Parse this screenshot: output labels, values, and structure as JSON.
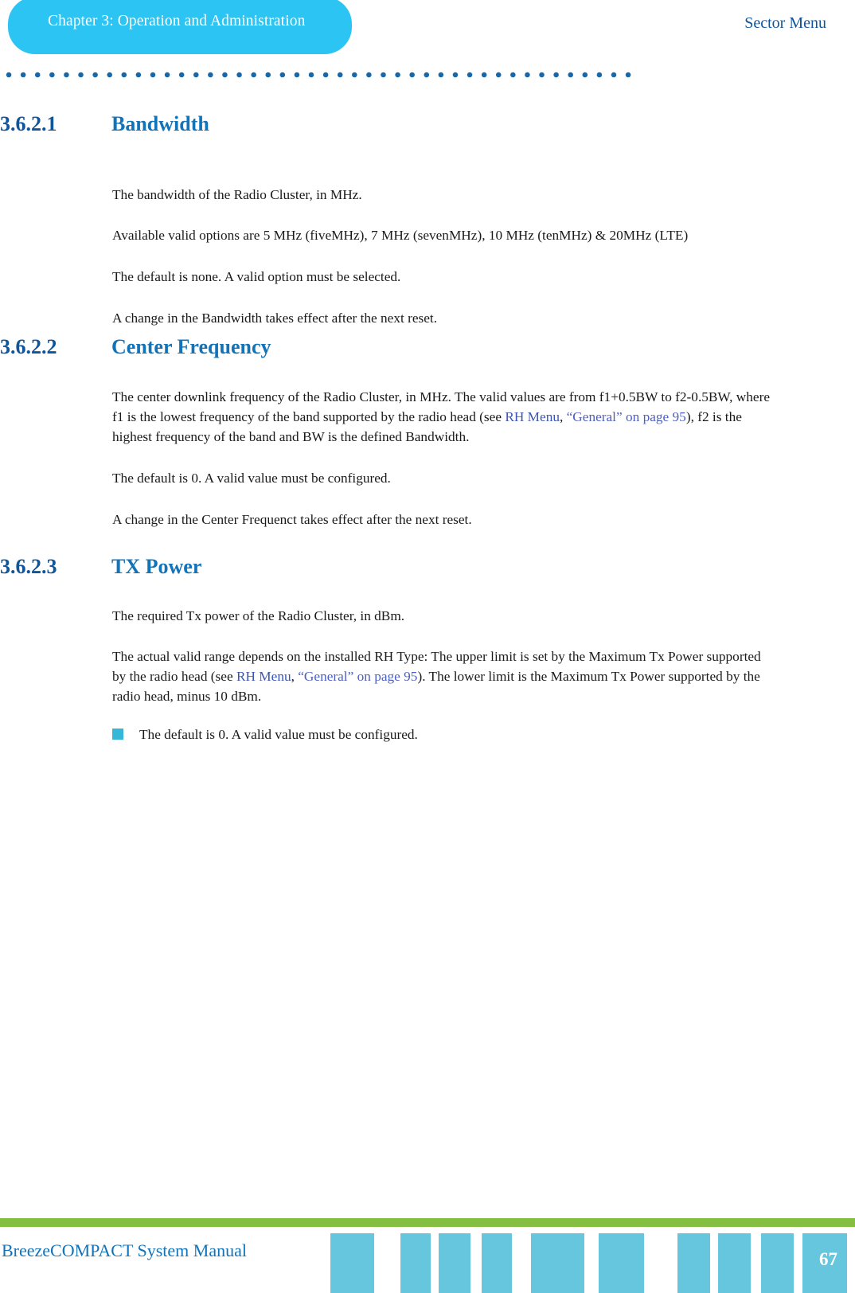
{
  "header": {
    "chapter_tab_label": "Chapter 3: Operation and Administration",
    "running_head": "Sector Menu"
  },
  "sections": [
    {
      "number": "3.6.2.1",
      "title": "Bandwidth",
      "paragraphs": [
        "The bandwidth of the Radio Cluster, in MHz.",
        "Available valid options are 5 MHz (fiveMHz), 7 MHz (sevenMHz), 10 MHz (tenMHz) & 20MHz (LTE)",
        "The default is none. A valid option must be selected.",
        "A change in the Bandwidth takes effect after the next reset."
      ]
    },
    {
      "number": "3.6.2.2",
      "title": "Center Frequency",
      "paragraph_1_part_1": "The center downlink frequency of the Radio Cluster, in MHz. The valid values are from f1+0.5BW to f2-0.5BW, where f1 is the lowest frequency of the band supported by the radio head (see ",
      "link_rh_menu": "RH Menu",
      "link_separator": ", ",
      "link_general": "“General” on page 95",
      "paragraph_1_part_2": "), f2 is the highest frequency of the band and BW is the defined Bandwidth.",
      "paragraphs": [
        "The default is 0. A valid value must be configured.",
        "A change in the Center Frequenct takes effect after the next reset."
      ]
    },
    {
      "number": "3.6.2.3",
      "title": "TX Power",
      "paragraphs": [
        "The required Tx power of the Radio Cluster, in dBm."
      ],
      "paragraph_2_part_1": "The actual valid range depends on the installed RH Type: The upper limit is set by the Maximum Tx Power supported by the radio head (see ",
      "link_rh_menu": "RH Menu",
      "link_separator": ", ",
      "link_general": "“General” on page 95",
      "paragraph_2_part_2": "). The lower limit is the Maximum Tx Power supported by the radio head, minus 10 dBm.",
      "bullet": "The default is 0. A valid value must be configured."
    }
  ],
  "footer": {
    "manual_title": "BreezeCOMPACT System Manual",
    "page_number": "67"
  },
  "colors": {
    "tab_cyan": "#2bc4f3",
    "heading_blue": "#10559a",
    "title_blue": "#1273b9",
    "link_blue": "#3a55b4",
    "footer_green": "#84bf41",
    "footer_block_cyan": "#66c6dd",
    "bullet_cyan": "#35b7d8"
  }
}
